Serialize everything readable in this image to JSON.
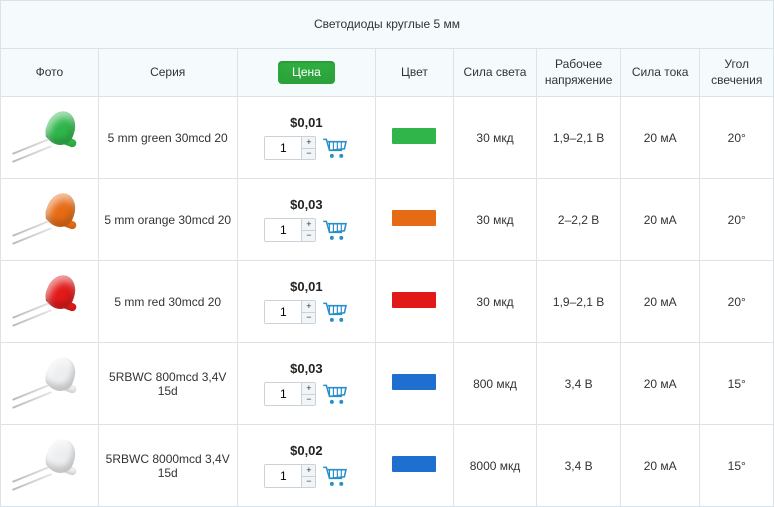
{
  "title": "Светодиоды круглые 5 мм",
  "cart_icon_color": "#2a8ecb",
  "headers": {
    "photo": "Фото",
    "series": "Серия",
    "price": "Цена",
    "color": "Цвет",
    "luminosity": "Сила света",
    "voltage": "Рабочее напряжение",
    "current": "Сила тока",
    "angle": "Угол свечения"
  },
  "rows": [
    {
      "series": "5 mm green 30mcd 20",
      "price": "$0,01",
      "qty": "1",
      "led_color": "#2fb54a",
      "swatch": "#2fb54a",
      "luminosity": "30 мкд",
      "voltage": "1,9–2,1 В",
      "current": "20 мА",
      "angle": "20°"
    },
    {
      "series": "5 mm orange 30mcd 20",
      "price": "$0,03",
      "qty": "1",
      "led_color": "#e66b15",
      "swatch": "#e66b15",
      "luminosity": "30 мкд",
      "voltage": "2–2,2 В",
      "current": "20 мА",
      "angle": "20°"
    },
    {
      "series": "5 mm red 30mcd 20",
      "price": "$0,01",
      "qty": "1",
      "led_color": "#e11919",
      "swatch": "#e11919",
      "luminosity": "30 мкд",
      "voltage": "1,9–2,1 В",
      "current": "20 мА",
      "angle": "20°"
    },
    {
      "series": "5RBWC 800mcd 3,4V 15d",
      "price": "$0,03",
      "qty": "1",
      "led_color": "#eceef0",
      "swatch": "#1f6fd1",
      "luminosity": "800 мкд",
      "voltage": "3,4 В",
      "current": "20 мА",
      "angle": "15°"
    },
    {
      "series": "5RBWC 8000mcd 3,4V 15d",
      "price": "$0,02",
      "qty": "1",
      "led_color": "#eceef0",
      "swatch": "#1f6fd1",
      "luminosity": "8000 мкд",
      "voltage": "3,4 В",
      "current": "20 мА",
      "angle": "15°"
    }
  ]
}
